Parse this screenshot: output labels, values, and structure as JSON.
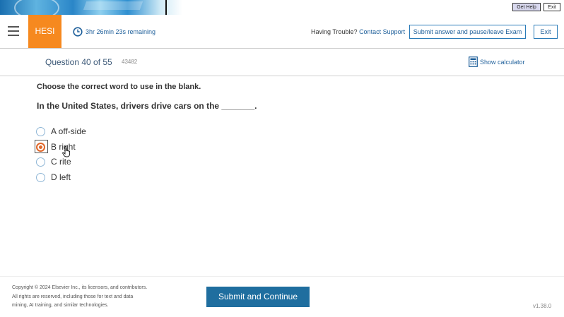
{
  "top_controls": {
    "get_help": "Get Help",
    "exit": "Exit"
  },
  "header": {
    "brand": "HESI",
    "timer": "3hr 26min 23s remaining",
    "trouble_text": "Having Trouble?",
    "contact_support": "Contact Support",
    "submit_pause": "Submit answer and pause/leave Exam",
    "exit": "Exit"
  },
  "question": {
    "number_label": "Question 40 of 55",
    "id": "43482",
    "show_calculator": "Show calculator",
    "instruction": "Choose the correct word to use in the blank.",
    "stem": "In the United States, drivers drive cars on the _______.",
    "options": [
      {
        "text": "A off-side",
        "selected": false
      },
      {
        "text": "B right",
        "selected": true
      },
      {
        "text": "C rite",
        "selected": false
      },
      {
        "text": "D left",
        "selected": false
      }
    ]
  },
  "footer": {
    "copyright_1": "Copyright © 2024 Elsevier Inc., its licensors, and contributors.",
    "copyright_2": "All rights are reserved, including those for text and data",
    "copyright_3": "mining, AI training, and similar technologies.",
    "submit_continue": "Submit and Continue",
    "version": "v1.38.0"
  },
  "colors": {
    "accent": "#f6891f",
    "primary": "#1f6e9f",
    "link": "#1e5f9a",
    "selected": "#e0672a"
  },
  "icons": [
    "menu-icon",
    "clock-icon",
    "calculator-icon",
    "hand-cursor-icon"
  ]
}
